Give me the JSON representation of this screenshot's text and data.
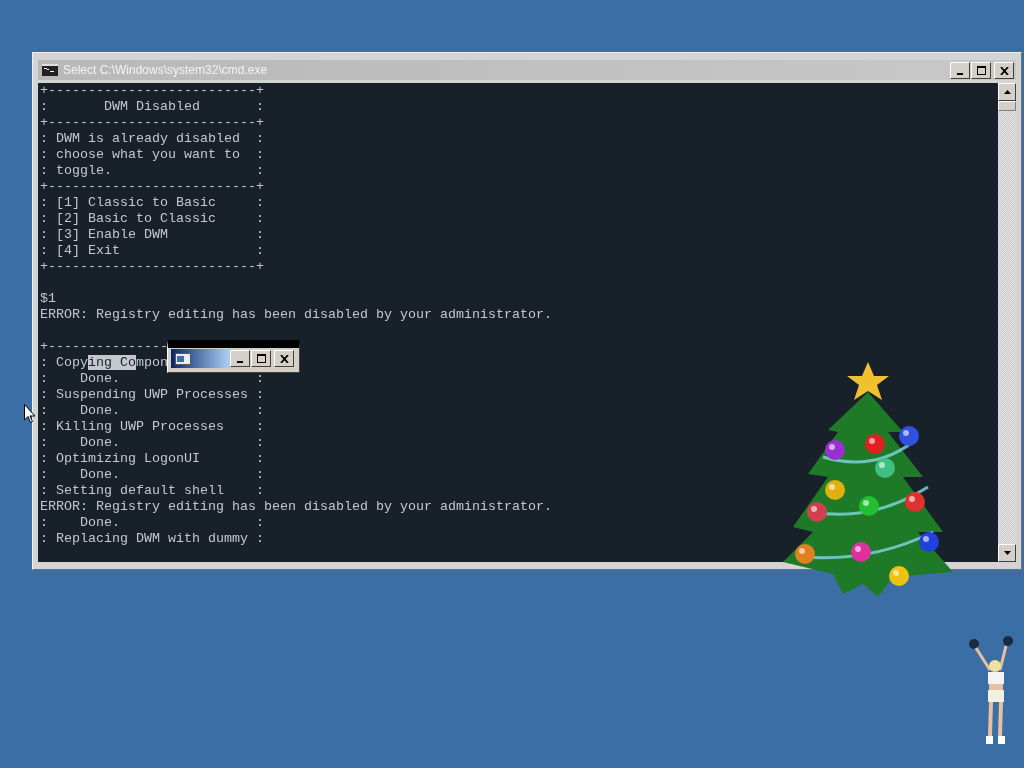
{
  "window": {
    "title": "Select C:\\Windows\\system32\\cmd.exe"
  },
  "console": {
    "lines": [
      {
        "kind": "text",
        "text": "+--------------------------+"
      },
      {
        "kind": "text",
        "text": ":       DWM Disabled       :"
      },
      {
        "kind": "text",
        "text": "+--------------------------+"
      },
      {
        "kind": "text",
        "text": ": DWM is already disabled  :"
      },
      {
        "kind": "text",
        "text": ": choose what you want to  :"
      },
      {
        "kind": "text",
        "text": ": toggle.                  :"
      },
      {
        "kind": "text",
        "text": "+--------------------------+"
      },
      {
        "kind": "text",
        "text": ": [1] Classic to Basic     :"
      },
      {
        "kind": "text",
        "text": ": [2] Basic to Classic     :"
      },
      {
        "kind": "text",
        "text": ": [3] Enable DWM           :"
      },
      {
        "kind": "text",
        "text": ": [4] Exit                 :"
      },
      {
        "kind": "text",
        "text": "+--------------------------+"
      },
      {
        "kind": "blank"
      },
      {
        "kind": "text",
        "text": "$1"
      },
      {
        "kind": "text",
        "text": "ERROR: Registry editing has been disabled by your administrator."
      },
      {
        "kind": "blank"
      },
      {
        "kind": "text",
        "text": "+---------------"
      },
      {
        "kind": "selection",
        "segments": [
          {
            "text": ": Copy",
            "selected": false
          },
          {
            "text": "ing Co",
            "selected": true
          },
          {
            "text": "mpon",
            "selected": false
          }
        ]
      },
      {
        "kind": "text",
        "text": ":    Done.                 :"
      },
      {
        "kind": "text",
        "text": ": Suspending UWP Processes :"
      },
      {
        "kind": "text",
        "text": ":    Done.                 :"
      },
      {
        "kind": "text",
        "text": ": Killing UWP Processes    :"
      },
      {
        "kind": "text",
        "text": ":    Done.                 :"
      },
      {
        "kind": "text",
        "text": ": Optimizing LogonUI       :"
      },
      {
        "kind": "text",
        "text": ":    Done.                 :"
      },
      {
        "kind": "text",
        "text": ": Setting default shell    :"
      },
      {
        "kind": "text",
        "text": "ERROR: Registry editing has been disabled by your administrator."
      },
      {
        "kind": "text",
        "text": ":    Done.                 :"
      },
      {
        "kind": "text",
        "text": ": Replacing DWM with dummy :"
      }
    ]
  }
}
